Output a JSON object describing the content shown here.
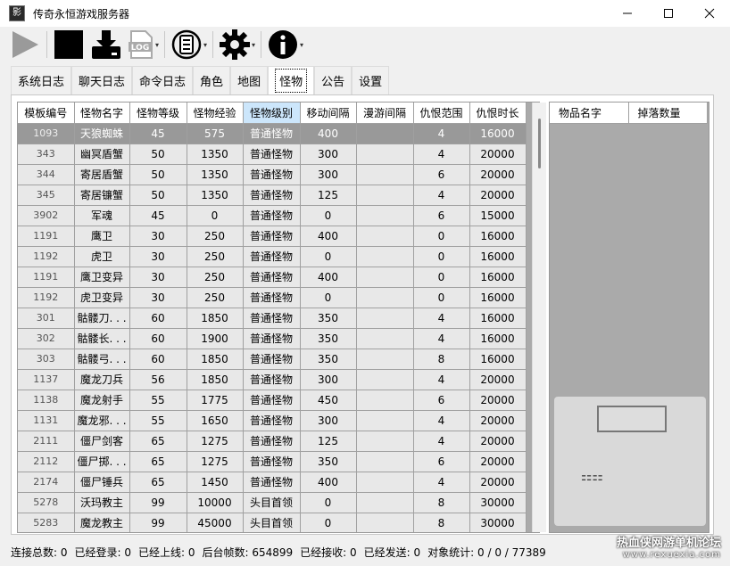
{
  "window": {
    "title": "传奇永恒游戏服务器",
    "app_icon_text": "影"
  },
  "toolbar": {
    "buttons": [
      {
        "name": "play-icon"
      },
      {
        "name": "stop-icon"
      },
      {
        "name": "download-icon"
      },
      {
        "name": "log-icon",
        "label": "LOG"
      },
      {
        "name": "database-icon"
      },
      {
        "name": "gear-icon"
      },
      {
        "name": "info-icon"
      }
    ]
  },
  "tabs": [
    {
      "label": "系统日志"
    },
    {
      "label": "聊天日志"
    },
    {
      "label": "命令日志"
    },
    {
      "label": "角色"
    },
    {
      "label": "地图"
    },
    {
      "label": "怪物",
      "active": true
    },
    {
      "label": "公告"
    },
    {
      "label": "设置"
    }
  ],
  "monster_table": {
    "columns": [
      "模板编号",
      "怪物名字",
      "怪物等级",
      "怪物经验",
      "怪物级别",
      "移动间隔",
      "漫游间隔",
      "仇恨范围",
      "仇恨时长"
    ],
    "sorted_column": 4,
    "rows": [
      [
        "1093",
        "天狼蜘蛛",
        "45",
        "575",
        "普通怪物",
        "400",
        "",
        "4",
        "16000"
      ],
      [
        "343",
        "幽冥盾蟹",
        "50",
        "1350",
        "普通怪物",
        "300",
        "",
        "4",
        "20000"
      ],
      [
        "344",
        "寄居盾蟹",
        "50",
        "1350",
        "普通怪物",
        "300",
        "",
        "6",
        "20000"
      ],
      [
        "345",
        "寄居镰蟹",
        "50",
        "1350",
        "普通怪物",
        "125",
        "",
        "4",
        "20000"
      ],
      [
        "3902",
        "军魂",
        "45",
        "0",
        "普通怪物",
        "0",
        "",
        "6",
        "15000"
      ],
      [
        "1191",
        "鹰卫",
        "30",
        "250",
        "普通怪物",
        "400",
        "",
        "0",
        "16000"
      ],
      [
        "1192",
        "虎卫",
        "30",
        "250",
        "普通怪物",
        "0",
        "",
        "0",
        "16000"
      ],
      [
        "1191",
        "鹰卫变异",
        "30",
        "250",
        "普通怪物",
        "400",
        "",
        "0",
        "16000"
      ],
      [
        "1192",
        "虎卫变异",
        "30",
        "250",
        "普通怪物",
        "0",
        "",
        "0",
        "16000"
      ],
      [
        "301",
        "骷髅刀. . .",
        "60",
        "1850",
        "普通怪物",
        "350",
        "",
        "4",
        "16000"
      ],
      [
        "302",
        "骷髅长. . .",
        "60",
        "1900",
        "普通怪物",
        "350",
        "",
        "4",
        "16000"
      ],
      [
        "303",
        "骷髅弓. . .",
        "60",
        "1850",
        "普通怪物",
        "350",
        "",
        "8",
        "16000"
      ],
      [
        "1137",
        "魔龙刀兵",
        "56",
        "1850",
        "普通怪物",
        "300",
        "",
        "4",
        "20000"
      ],
      [
        "1138",
        "魔龙射手",
        "55",
        "1775",
        "普通怪物",
        "450",
        "",
        "6",
        "20000"
      ],
      [
        "1131",
        "魔龙邪. . .",
        "55",
        "1650",
        "普通怪物",
        "300",
        "",
        "4",
        "20000"
      ],
      [
        "2111",
        "僵尸剑客",
        "65",
        "1275",
        "普通怪物",
        "125",
        "",
        "4",
        "20000"
      ],
      [
        "2112",
        "僵尸掷. . .",
        "65",
        "1275",
        "普通怪物",
        "350",
        "",
        "6",
        "20000"
      ],
      [
        "2174",
        "僵尸锤兵",
        "65",
        "1450",
        "普通怪物",
        "400",
        "",
        "4",
        "20000"
      ],
      [
        "5278",
        "沃玛教主",
        "99",
        "10000",
        "头目首领",
        "0",
        "",
        "8",
        "30000"
      ],
      [
        "5283",
        "魔龙教主",
        "99",
        "45000",
        "头目首领",
        "0",
        "",
        "8",
        "30000"
      ]
    ],
    "selected_row": 0
  },
  "drop_table": {
    "columns": [
      "物品名字",
      "掉落数量"
    ]
  },
  "status": {
    "items": [
      "连接总数: 0",
      "已经登录: 0",
      "已经上线: 0",
      "后台帧数: 654899",
      "已经接收: 0",
      "已经发送: 0",
      "对象统计: 0 / 0 / 77389"
    ]
  },
  "site_mark": {
    "line1": "热血侠网游单机论坛",
    "line2": "www.rexuexia.com"
  }
}
